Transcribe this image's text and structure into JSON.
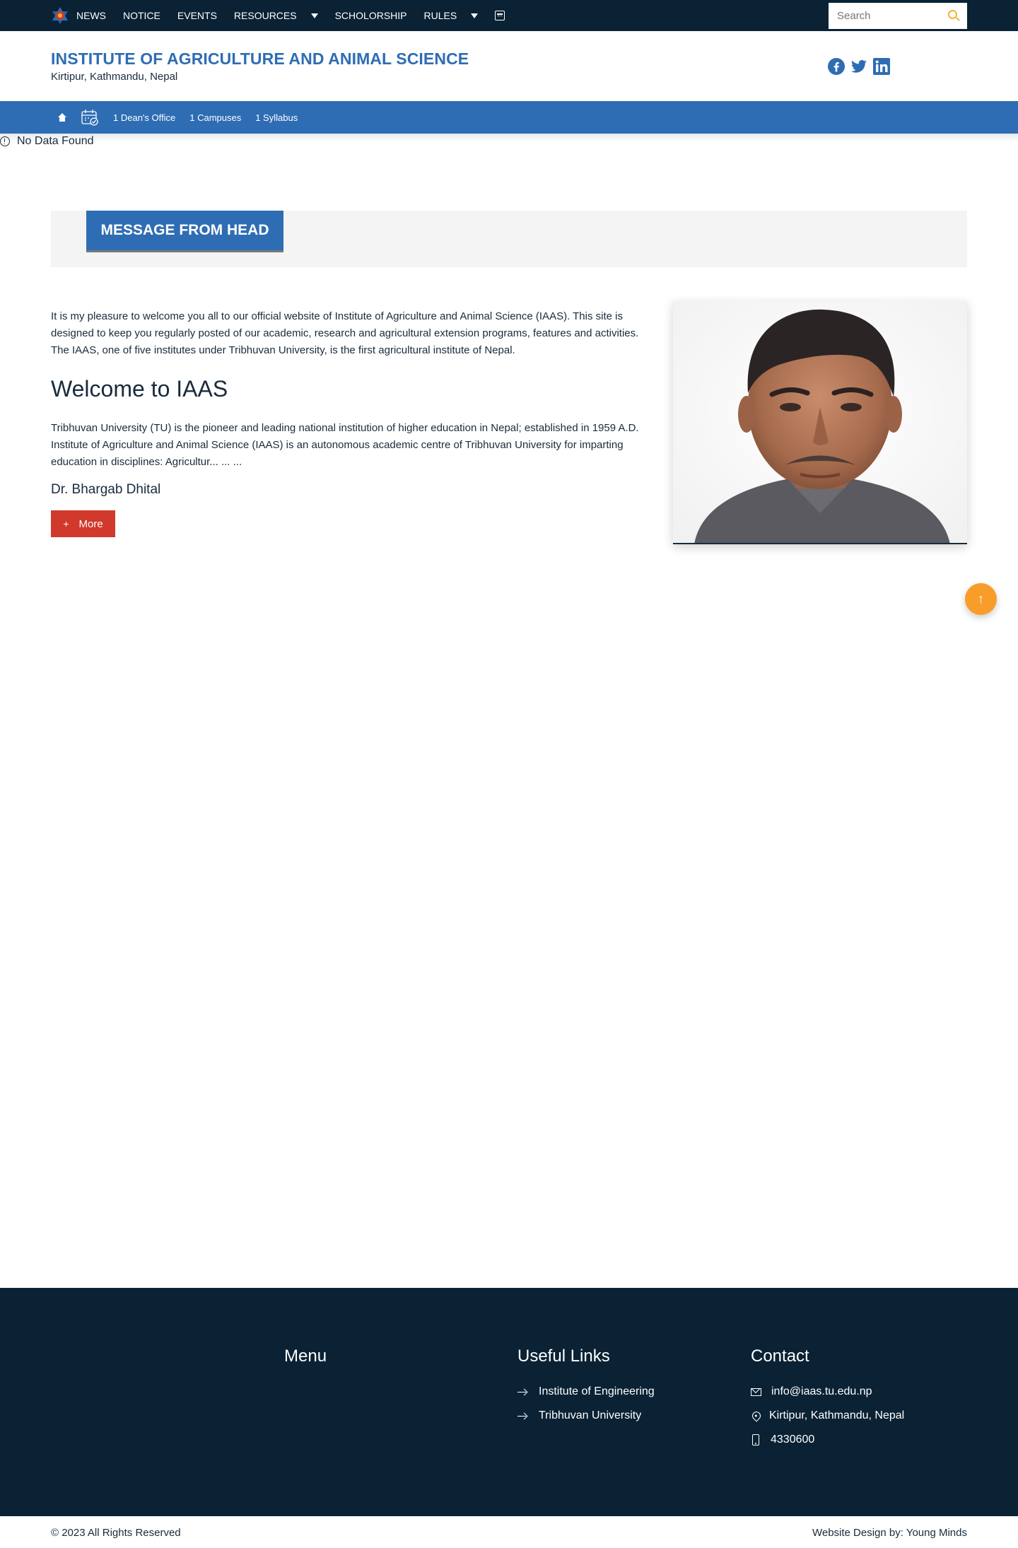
{
  "topnav": {
    "items": [
      {
        "label": "NEWS"
      },
      {
        "label": "NOTICE"
      },
      {
        "label": "EVENTS"
      },
      {
        "label": "RESOURCES"
      },
      {
        "label": "SCHOLORSHIP"
      },
      {
        "label": "RULES"
      }
    ],
    "search_placeholder": "Search"
  },
  "header": {
    "title": "INSTITUTE OF AGRICULTURE AND ANIMAL SCIENCE",
    "subtitle": "Kirtipur, Kathmandu, Nepal",
    "social": [
      "facebook-icon",
      "twitter-icon",
      "linkedin-icon"
    ]
  },
  "subnav": {
    "items": [
      {
        "label": "1 Dean's Office"
      },
      {
        "label": "1 Campuses"
      },
      {
        "label": "1 Syllabus"
      }
    ]
  },
  "notice": {
    "text": "No Data Found"
  },
  "message": {
    "heading": "MESSAGE FROM HEAD",
    "intro": "It is my pleasure to welcome you all to our official website of Institute of Agriculture and Animal Science (IAAS). This site is designed to keep you regularly posted of our academic, research and agricultural extension programs, features and activities. The IAAS, one of five institutes under Tribhuvan University, is the first agricultural institute of Nepal.",
    "welcome": "Welcome to IAAS",
    "description": "Tribhuvan University (TU) is the pioneer and leading national institution of higher education in Nepal; established in 1959 A.D. Institute of Agriculture and Animal Science (IAAS) is an autonomous academic centre of Tribhuvan University for imparting education in disciplines: Agricultur... ... ...",
    "name": "Dr. Bhargab Dhital",
    "more_label": "More",
    "more_symbol": "+"
  },
  "scroll_top_symbol": "↑",
  "footer": {
    "menu_title": "Menu",
    "useful_title": "Useful Links",
    "useful_links": [
      {
        "label": "Institute of Engineering"
      },
      {
        "label": "Tribhuvan University"
      }
    ],
    "contact_title": "Contact",
    "contact": {
      "email": "info@iaas.tu.edu.np",
      "address": "Kirtipur, Kathmandu, Nepal",
      "phone": "4330600"
    }
  },
  "bottom": {
    "copyright": "© 2023 All Rights Reserved",
    "credit": "Website Design by: Young Minds"
  },
  "colors": {
    "topbar": "#0a2234",
    "primary": "#2e6db4",
    "more_button": "#d0392b",
    "scroll_top": "#f99d2a",
    "search_icon": "#f2b233"
  }
}
